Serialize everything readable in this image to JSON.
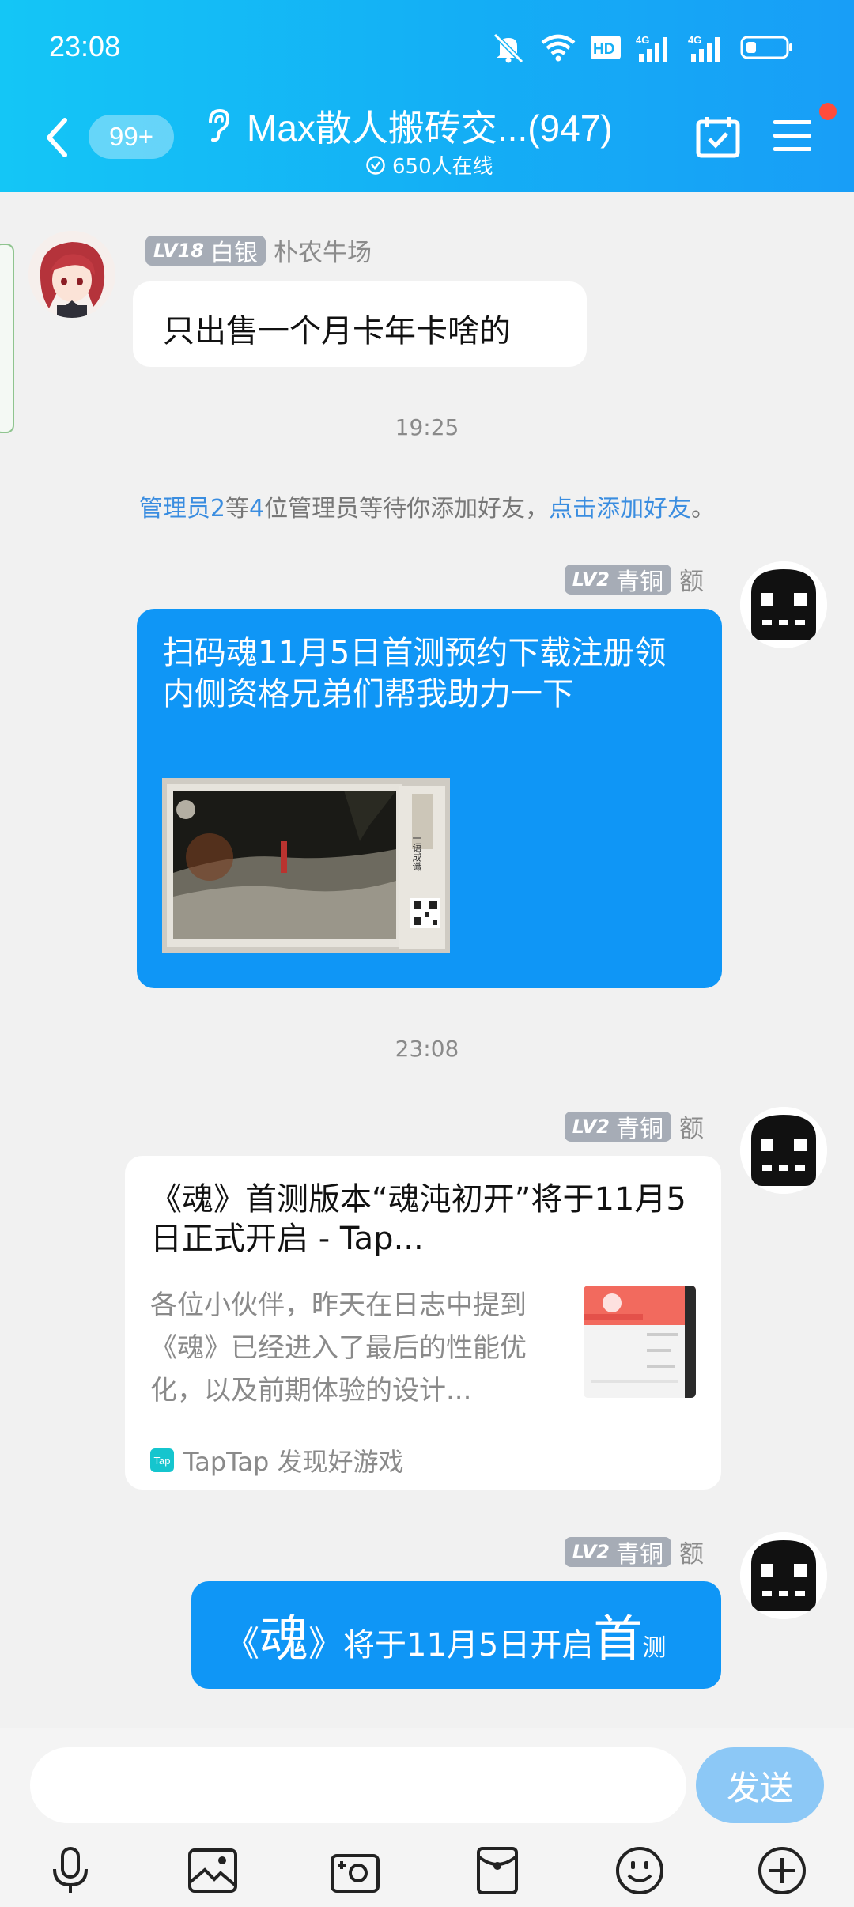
{
  "status_bar": {
    "time": "23:08"
  },
  "header": {
    "unread_count": "99+",
    "group_name": "Max散人搬砖交...(947)",
    "online_count": "650人在线"
  },
  "messages": [
    {
      "sender_name": "朴农牛场",
      "level": "LV18",
      "rank": "白银",
      "text": "只出售一个月卡年卡啥的"
    },
    {
      "sender_name": "额",
      "level": "LV2",
      "rank": "青铜",
      "text": "扫码魂11月5日首测预约下载注册领内侧资格兄弟们帮我助力一下",
      "image_lines": [
        "一语成谶"
      ]
    },
    {
      "sender_name": "额",
      "level": "LV2",
      "rank": "青铜",
      "card": {
        "title": "《魂》首测版本“魂沌初开”将于11月5日正式开启 - Tap...",
        "summary": "各位小伙伴，昨天在日志中提到《魂》已经进入了最后的性能优化，以及前期体验的设计...",
        "source_logo": "Tap",
        "source": "TapTap 发现好游戏"
      }
    },
    {
      "sender_name": "额",
      "level": "LV2",
      "rank": "青铜",
      "rich_parts": [
        "《",
        "魂",
        "》",
        "将于11月5日开启",
        "首",
        "测"
      ]
    }
  ],
  "timestamps": [
    "19:25",
    "23:08"
  ],
  "system_notice": {
    "admin": "管理员2",
    "t1": "等",
    "count": "4",
    "t2": "位管理员等待你添加好友，",
    "link": "点击添加好友",
    "t3": "。"
  },
  "input": {
    "placeholder": "",
    "send_label": "发送"
  },
  "toolbar_icons": [
    "microphone-icon",
    "photo-icon",
    "camera-icon",
    "red-packet-icon",
    "emoji-icon",
    "plus-icon"
  ],
  "colors": {
    "header": "#14aef5",
    "bubble_blue": "#0f96f6",
    "link": "#3a8de0"
  }
}
